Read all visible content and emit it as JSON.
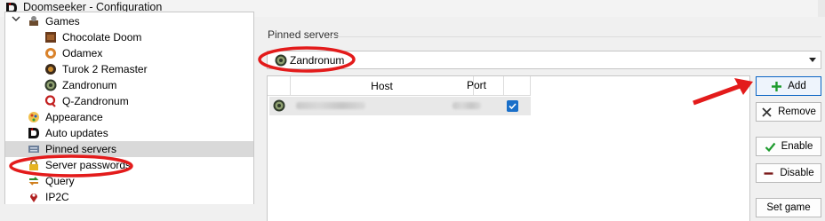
{
  "window": {
    "title": "Doomseeker - Configuration"
  },
  "tree": {
    "items": [
      {
        "label": "Games",
        "icon": "games-icon",
        "indent": 0,
        "expanded": true
      },
      {
        "label": "Chocolate Doom",
        "icon": "chocolate-doom-icon",
        "indent": 1
      },
      {
        "label": "Odamex",
        "icon": "odamex-icon",
        "indent": 1
      },
      {
        "label": "Turok 2 Remaster",
        "icon": "turok-icon",
        "indent": 1
      },
      {
        "label": "Zandronum",
        "icon": "zandronum-icon",
        "indent": 1
      },
      {
        "label": "Q-Zandronum",
        "icon": "q-zandronum-icon",
        "indent": 1
      },
      {
        "label": "Appearance",
        "icon": "appearance-icon",
        "indent": 0
      },
      {
        "label": "Auto updates",
        "icon": "auto-updates-icon",
        "indent": 0
      },
      {
        "label": "Pinned servers",
        "icon": "pinned-servers-icon",
        "indent": 0,
        "selected": true
      },
      {
        "label": "Server passwords",
        "icon": "lock-icon",
        "indent": 0
      },
      {
        "label": "Query",
        "icon": "query-icon",
        "indent": 0
      },
      {
        "label": "IP2C",
        "icon": "map-pin-icon",
        "indent": 0
      }
    ]
  },
  "pinned": {
    "group_label": "Pinned servers",
    "engine_selected": "Zandronum",
    "columns": [
      "Host",
      "Port"
    ],
    "rows": [
      {
        "host": "",
        "port": "",
        "checked": true
      }
    ]
  },
  "buttons": {
    "add": "Add",
    "remove": "Remove",
    "enable": "Enable",
    "disable": "Disable",
    "set_game": "Set game"
  },
  "colors": {
    "accent": "#1a6fc9",
    "annotation_red": "#e31b1b",
    "add_green": "#1e9b2e",
    "remove_dark": "#333333",
    "disable_dark_red": "#7a1a1a"
  }
}
